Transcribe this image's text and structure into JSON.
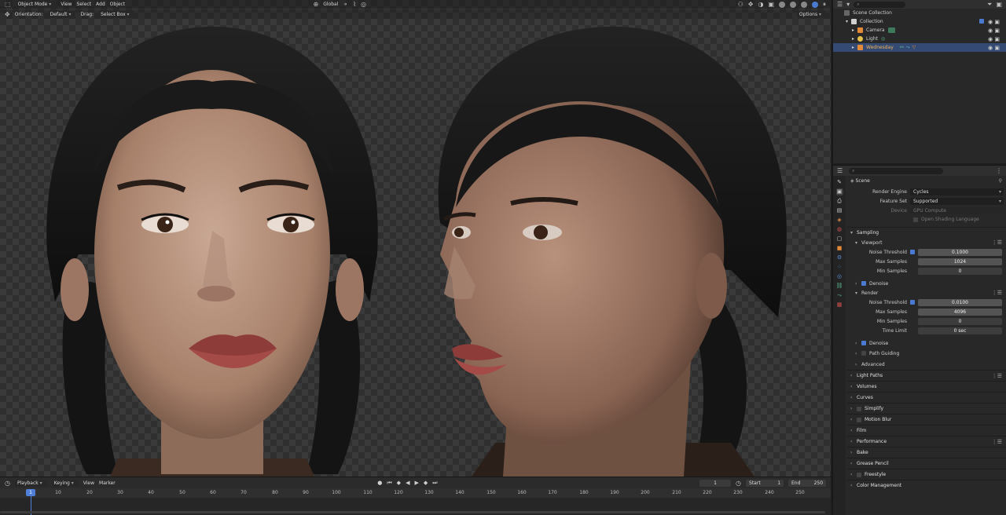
{
  "viewport": {
    "header": {
      "mode": "Object Mode",
      "menus": [
        "View",
        "Select",
        "Add",
        "Object"
      ],
      "transform": "Global",
      "options": "Options"
    },
    "toolbar": {
      "orientation_label": "Orientation:",
      "orientation_value": "Default",
      "drag_label": "Drag:",
      "drag_value": "Select Box"
    }
  },
  "timeline": {
    "menus": [
      "Playback",
      "Keying",
      "View",
      "Marker"
    ],
    "current_frame": "1",
    "start_label": "Start",
    "start": "1",
    "end_label": "End",
    "end": "250",
    "ticks": [
      "10",
      "20",
      "30",
      "40",
      "50",
      "60",
      "70",
      "80",
      "90",
      "100",
      "110",
      "120",
      "130",
      "140",
      "150",
      "160",
      "170",
      "180",
      "190",
      "200",
      "210",
      "220",
      "230",
      "240",
      "250"
    ],
    "playhead": "1"
  },
  "outliner": {
    "rows": [
      {
        "label": "Scene Collection"
      },
      {
        "label": "Collection"
      },
      {
        "label": "Camera"
      },
      {
        "label": "Light"
      },
      {
        "label": "Wednesday"
      }
    ]
  },
  "properties": {
    "context": "Scene",
    "render_engine_label": "Render Engine",
    "render_engine": "Cycles",
    "feature_set_label": "Feature Set",
    "feature_set": "Supported",
    "device_label": "Device",
    "device": "GPU Compute",
    "osl_label": "Open Shading Language",
    "sampling": "Sampling",
    "viewport": {
      "title": "Viewport",
      "noise_label": "Noise Threshold",
      "noise": "0.1000",
      "max_label": "Max Samples",
      "max": "1024",
      "min_label": "Min Samples",
      "min": "0",
      "denoise": "Denoise"
    },
    "render": {
      "title": "Render",
      "noise_label": "Noise Threshold",
      "noise": "0.0100",
      "max_label": "Max Samples",
      "max": "4096",
      "min_label": "Min Samples",
      "min": "0",
      "time_label": "Time Limit",
      "time": "0 sec",
      "denoise": "Denoise",
      "path_guiding": "Path Guiding",
      "advanced": "Advanced"
    },
    "sections": [
      "Light Paths",
      "Volumes",
      "Curves",
      "Simplify",
      "Motion Blur",
      "Film",
      "Performance",
      "Bake",
      "Grease Pencil",
      "Freestyle",
      "Color Management"
    ]
  },
  "colors": {
    "accent": "#4a7bd0",
    "selection": "#344a73",
    "camera": "#e08a3a",
    "light": "#e6c14a"
  }
}
